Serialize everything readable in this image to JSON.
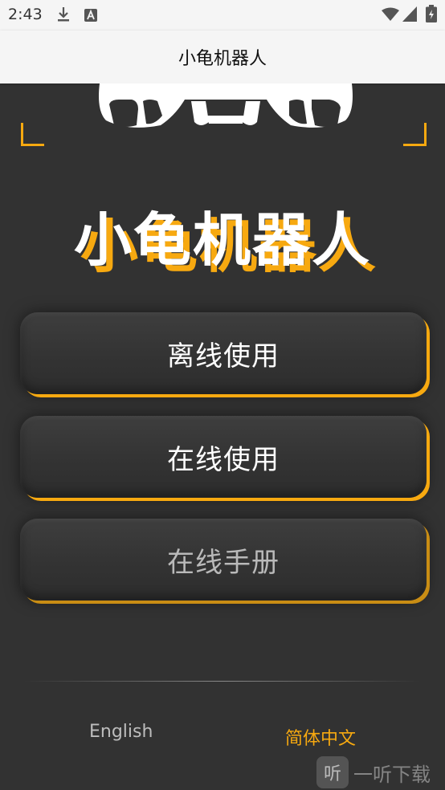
{
  "status_bar": {
    "time": "2:43",
    "icons": [
      "download-icon",
      "a-box-icon",
      "wifi-icon",
      "signal-icon",
      "battery-charging-icon"
    ]
  },
  "title_bar": {
    "title": "小龟机器人"
  },
  "hero": {
    "title": "小龟机器人"
  },
  "menu": {
    "offline_label": "离线使用",
    "online_label": "在线使用",
    "manual_label": "在线手册"
  },
  "language": {
    "english": "English",
    "chinese": "简体中文"
  },
  "watermark": {
    "badge": "听",
    "text": "一听下载"
  },
  "colors": {
    "accent": "#f7a910",
    "background": "#323232",
    "title_bar": "#f5f5f5"
  }
}
